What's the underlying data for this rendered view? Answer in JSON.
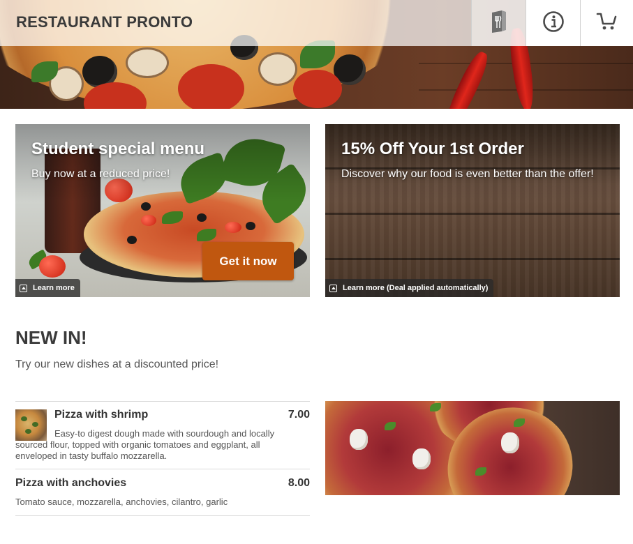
{
  "header": {
    "brand": "RESTAURANT PRONTO",
    "buttons": [
      {
        "icon": "menu-book-icon"
      },
      {
        "icon": "info-icon"
      },
      {
        "icon": "cart-icon"
      }
    ]
  },
  "promos": [
    {
      "title": "Student special menu",
      "subtitle": "Buy now at a reduced price!",
      "cta": "Get it now",
      "learn_more": "Learn more"
    },
    {
      "title": "15% Off Your 1st Order",
      "subtitle": "Discover why our food is even better than the offer!",
      "learn_more": "Learn more (Deal applied automatically)"
    }
  ],
  "new_in": {
    "title": "NEW IN!",
    "subtitle": "Try our new dishes at a discounted price!",
    "dishes": [
      {
        "name": "Pizza with shrimp",
        "price": "7.00",
        "description": "Easy-to digest dough made with sourdough and locally sourced flour, topped with organic tomatoes and eggplant, all enveloped in tasty buffalo mozzarella."
      },
      {
        "name": "Pizza with anchovies",
        "price": "8.00",
        "description": "Tomato sauce, mozzarella, anchovies, cilantro, garlic"
      }
    ]
  },
  "colors": {
    "accent": "#c0570f",
    "text": "#333333"
  }
}
